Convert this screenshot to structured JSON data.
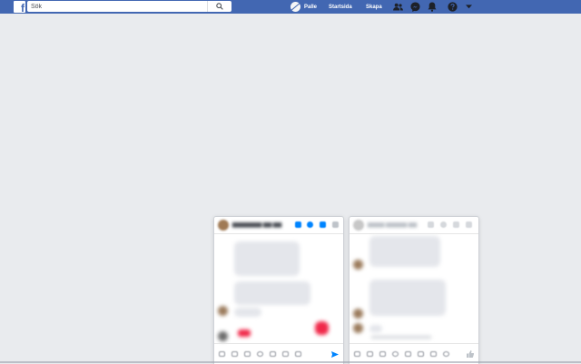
{
  "header": {
    "logo": "f",
    "search_placeholder": "Sök",
    "profile_name": "Palle",
    "home_label": "Startsida",
    "create_label": "Skapa"
  },
  "icons": {
    "search": "search-icon",
    "friends": "friend-requests-icon",
    "messenger": "messenger-icon",
    "notifications": "notifications-icon",
    "help": "help-icon",
    "menu": "chevron-down-icon"
  },
  "colors": {
    "brand": "#4267b2",
    "page_background": "#e9ebee",
    "messenger_blue": "#0084ff",
    "heart_red": "#f02849"
  }
}
